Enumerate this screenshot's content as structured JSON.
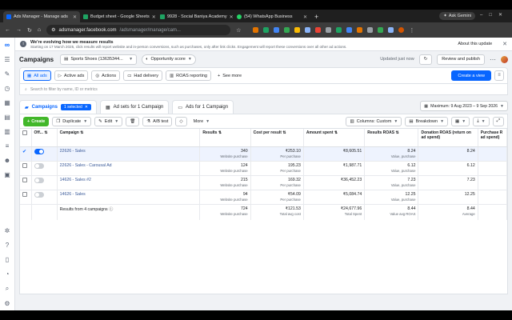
{
  "browser": {
    "tabs": [
      {
        "label": "Ads Manager - Manage ads",
        "color": "#0866ff",
        "active": true
      },
      {
        "label": "Budget sheet - Google Sheets",
        "color": "#1ea362",
        "active": false
      },
      {
        "label": "9928 - Social Baniya Academy",
        "color": "#1ea362",
        "active": false
      },
      {
        "label": "(54) WhatsApp Business",
        "color": "#25d366",
        "active": false
      }
    ],
    "new_tab": "+",
    "ask_gemini": "Ask Gemini",
    "url_host": "adsmanager.facebook.com",
    "url_path": "/adsmanager/manage/cam..."
  },
  "notice": {
    "title": "We're evolving how we measure results",
    "body": "Starting on 17 March 2025, click results will report website and in-person conversions, such as purchases, only after link clicks. Engagement will report these conversions over all other ad actions.",
    "about": "About this update"
  },
  "topbar": {
    "title": "Campaigns",
    "account": "Sports Shoes (13635344...",
    "opportunity": "Opportunity score",
    "updated": "Updated just now",
    "review": "Review and publish"
  },
  "quick_tabs": [
    {
      "label": "All ads",
      "icon": "grid-icon",
      "selected": true
    },
    {
      "label": "Active ads",
      "icon": "play-icon",
      "selected": false
    },
    {
      "label": "Actions",
      "icon": "target-icon",
      "selected": false
    },
    {
      "label": "Had delivery",
      "icon": "truck-icon",
      "selected": false
    },
    {
      "label": "ROAS reporting",
      "icon": "chart-icon",
      "selected": false
    },
    {
      "label": "See more",
      "icon": "plus-icon",
      "selected": false
    }
  ],
  "create_view": "Create a view",
  "search": {
    "placeholder": "Search to filter by name, ID or metrics"
  },
  "levels": {
    "campaigns": "Campaigns",
    "selected_badge": "1 selected",
    "adsets": "Ad sets for 1 Campaign",
    "ads": "Ads for 1 Campaign"
  },
  "date_range": "Maximum: 9 Aug 2023 – 9 Sep 2026",
  "toolbar": {
    "create": "Create",
    "duplicate": "Duplicate",
    "edit": "Edit",
    "ab_test": "A/B test",
    "more": "More",
    "columns": "Columns: Custom",
    "breakdown": "Breakdown"
  },
  "table": {
    "headers": {
      "off": "Off...",
      "campaign": "Campaign",
      "results": "Results",
      "cpr": "Cost per result",
      "spent": "Amount spent",
      "roas": "Results ROAS",
      "donation": "Donation ROAS (return on ad spend)",
      "purchase": "Purchase R ad spend)"
    },
    "rows": [
      {
        "name": "22626 - Sales",
        "on": true,
        "selected": true,
        "results": "340",
        "results_sub": "Website purchase",
        "cpr": "₹253.10",
        "cpr_sub": "Per purchase",
        "spent": "₹8,605.51",
        "roas": "8.24",
        "roas_sub": "Value, purchase",
        "donation": "8.24"
      },
      {
        "name": "22626 - Sales - Carousal Ad",
        "on": false,
        "selected": false,
        "results": "124",
        "results_sub": "Website purchase",
        "cpr": "195.23",
        "cpr_sub": "Per purchase",
        "spent": "₹1,987.71",
        "roas": "6.12",
        "roas_sub": "Value, purchase",
        "donation": "6.12"
      },
      {
        "name": "14626 - Sales #2",
        "on": false,
        "selected": false,
        "results": "215",
        "results_sub": "Website purchase",
        "cpr": "169.32",
        "cpr_sub": "Per purchase",
        "spent": "₹36,452.23",
        "roas": "7.23",
        "roas_sub": "Value, purchase",
        "donation": "7.23"
      },
      {
        "name": "14626 - Sales",
        "on": false,
        "selected": false,
        "results": "94",
        "results_sub": "Website purchase",
        "cpr": "₹54.09",
        "cpr_sub": "Per purchase",
        "spent": "₹5,084.74",
        "roas": "12.25",
        "roas_sub": "Value, purchase",
        "donation": "12.25"
      }
    ],
    "total": {
      "label": "Results from 4 campaigns",
      "results": "724",
      "results_sub": "Website purchase",
      "cpr": "₹121.53",
      "cpr_sub": "Total avg cost",
      "spent": "₹24,677.96",
      "spent_sub": "Total Spent",
      "roas": "8.44",
      "roas_sub": "Value avg ROAS",
      "donation": "8.44",
      "donation_sub": "Average"
    }
  }
}
